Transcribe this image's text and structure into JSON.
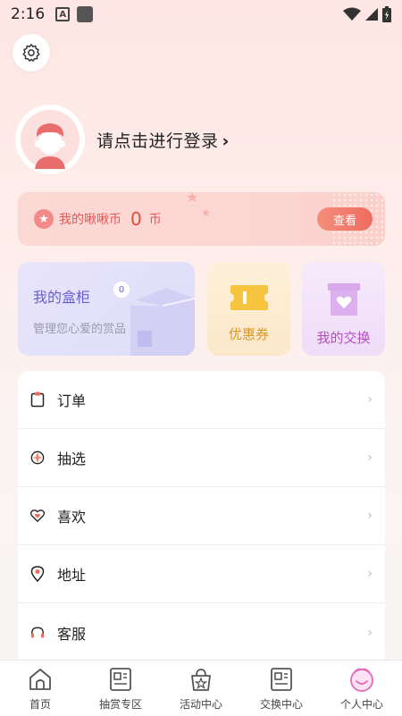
{
  "status_bar": {
    "time": "2:16",
    "a_icon": "A"
  },
  "profile": {
    "login_text": "请点击进行登录",
    "chevron": "›"
  },
  "coins": {
    "label": "我的啾啾币",
    "value": "0",
    "unit": "币",
    "view_button": "查看"
  },
  "cabinet": {
    "title": "我的盒柜",
    "badge": "0",
    "subtitle": "管理您心爱的赏品"
  },
  "coupon": {
    "label": "优惠券"
  },
  "exchange": {
    "label": "我的交换"
  },
  "menu": {
    "items": [
      {
        "label": "订单",
        "icon": "order-icon"
      },
      {
        "label": "抽选",
        "icon": "draw-icon"
      },
      {
        "label": "喜欢",
        "icon": "heart-icon"
      },
      {
        "label": "地址",
        "icon": "location-icon"
      },
      {
        "label": "客服",
        "icon": "headset-icon"
      }
    ],
    "chevron": "›"
  },
  "tabbar": {
    "tabs": [
      {
        "label": "首页",
        "icon": "home-icon"
      },
      {
        "label": "抽赏专区",
        "icon": "reward-icon"
      },
      {
        "label": "活动中心",
        "icon": "activity-icon"
      },
      {
        "label": "交换中心",
        "icon": "exchange-icon"
      },
      {
        "label": "个人中心",
        "icon": "profile-icon",
        "active": true
      }
    ]
  },
  "colors": {
    "accent": "#ee6c5f",
    "coin_text": "#e05a5a",
    "cabinet_title": "#6b5fd0",
    "coupon_text": "#d9982a",
    "exchange_text": "#b44fbf"
  }
}
